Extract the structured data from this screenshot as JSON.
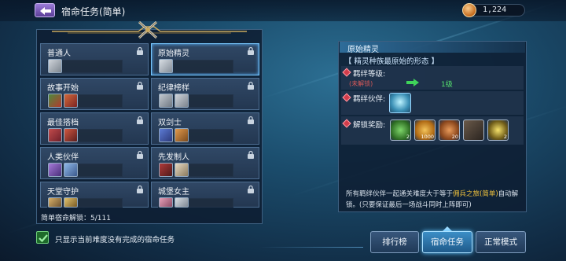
{
  "header": {
    "title": "宿命任务(简单)",
    "currency_value": "1,224",
    "back_icon": "back-arrow-icon",
    "currency_icon": "coin-icon"
  },
  "list": {
    "cells": [
      {
        "name": "普通人",
        "locked": true
      },
      {
        "name": "原始精灵",
        "locked": true,
        "selected": true
      },
      {
        "name": "故事开始",
        "locked": true
      },
      {
        "name": "纪律榜样",
        "locked": true
      },
      {
        "name": "最佳搭档",
        "locked": true
      },
      {
        "name": "双剑士",
        "locked": true
      },
      {
        "name": "人类伙伴",
        "locked": true
      },
      {
        "name": "先发制人",
        "locked": true
      },
      {
        "name": "天堂守护",
        "locked": true
      },
      {
        "name": "城堡女主",
        "locked": true
      }
    ],
    "unlock_count": "简单宿命解锁：5/111"
  },
  "detail": {
    "title": "原始精灵",
    "subtitle": "【 精灵种族最原始的形态 】",
    "bond_level_label": "羁绊等级:",
    "level_from": "(未解锁)",
    "level_to": "1级",
    "partner_label": "羁绊伙伴:",
    "reward_label": "解锁奖励:",
    "rewards": [
      {
        "icon": "green-gem-icon",
        "count": "2"
      },
      {
        "icon": "gold-coin-icon",
        "count": "1000"
      },
      {
        "icon": "bronze-coin-icon",
        "count": "20"
      },
      {
        "icon": "boot-icon",
        "count": ""
      },
      {
        "icon": "sparkle-star-icon",
        "count": "2"
      }
    ],
    "note_part1": "所有羁绊伙伴一起通关难度大于等于",
    "note_highlight": "佣兵之旅(简单)",
    "note_part2": "自动解锁。(只要保证最后一场战斗同时上阵即可)"
  },
  "footer": {
    "checkbox_label": "只显示当前难度没有完成的宿命任务",
    "checked": true,
    "buttons": [
      "排行榜",
      "宿命任务",
      "正常模式"
    ],
    "active_button": "宿命任务"
  },
  "colors": {
    "accent": "#3c8ec6",
    "lock_red": "#d65959",
    "unlock_green": "#55e06e",
    "highlight_gold": "#f0c23d"
  }
}
